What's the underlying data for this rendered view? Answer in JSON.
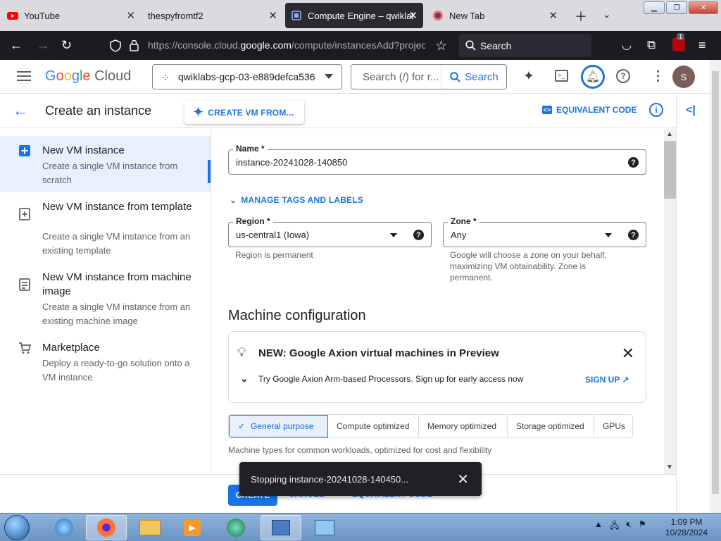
{
  "browser": {
    "tabs": [
      {
        "label": "YouTube",
        "icon": "youtube-icon",
        "active": false
      },
      {
        "label": "thespyfromtf2",
        "icon": "",
        "active": false
      },
      {
        "label": "Compute Engine – qwiklab",
        "icon": "compute-engine-icon",
        "active": true
      },
      {
        "label": "New Tab",
        "icon": "firefox-icon",
        "active": false
      }
    ],
    "url_prefix": "https://console.cloud.",
    "url_domain": "google.com",
    "url_suffix": "/compute/instancesAdd?project",
    "search_placeholder": "Search",
    "extension_badge": "1"
  },
  "header": {
    "logo_google": [
      "G",
      "o",
      "o",
      "g",
      "l",
      "e"
    ],
    "logo_cloud": "Cloud",
    "project_name": "qwiklabs-gcp-03-e889defca536",
    "search_placeholder": "Search (/) for r...",
    "search_button": "Search",
    "avatar_initial": "S"
  },
  "titlebar": {
    "back_label": "←",
    "title": "Create an instance",
    "create_from": "CREATE VM FROM...",
    "equivalent_code": "EQUIVALENT CODE",
    "info": "i"
  },
  "sidebar": {
    "items": [
      {
        "title": "New VM instance",
        "desc": "Create a single VM instance from scratch",
        "active": true
      },
      {
        "title": "New VM instance from template",
        "desc": "Create a single VM instance from an existing template",
        "active": false
      },
      {
        "title": "New VM instance from machine image",
        "desc": "Create a single VM instance from an existing machine image",
        "active": false
      },
      {
        "title": "Marketplace",
        "desc": "Deploy a ready-to-go solution onto a VM instance",
        "active": false
      }
    ]
  },
  "form": {
    "name_label": "Name *",
    "name_value": "instance-20241028-140850",
    "manage_tags": "MANAGE TAGS AND LABELS",
    "region_label": "Region *",
    "region_value": "us-central1 (Iowa)",
    "region_hint": "Region is permanent",
    "zone_label": "Zone *",
    "zone_value": "Any",
    "zone_hint": "Google will choose a zone on your behalf, maximizing VM obtainability. Zone is permanent.",
    "help_glyph": "?"
  },
  "machine": {
    "section_title": "Machine configuration",
    "banner_title": "NEW: Google Axion virtual machines in Preview",
    "banner_text": "Try Google Axion Arm-based Processors. Sign up for early access now",
    "banner_signup": "SIGN UP",
    "tabs": [
      "General purpose",
      "Compute optimized",
      "Memory optimized",
      "Storage optimized",
      "GPUs"
    ],
    "active_tab": "General purpose",
    "hint": "Machine types for common workloads, optimized for cost and flexibility"
  },
  "footer": {
    "create": "CREATE",
    "cancel": "CANCEL",
    "equivalent_code": "EQUIVALENT CODE"
  },
  "snackbar": {
    "message": "Stopping instance-20241028-140450..."
  },
  "taskbar": {
    "time": "1:09 PM",
    "date": "10/28/2024"
  },
  "colors": {
    "accent": "#1a73e8",
    "active_nav": "#e8f0fe",
    "browser_dark": "#1c1b22"
  }
}
